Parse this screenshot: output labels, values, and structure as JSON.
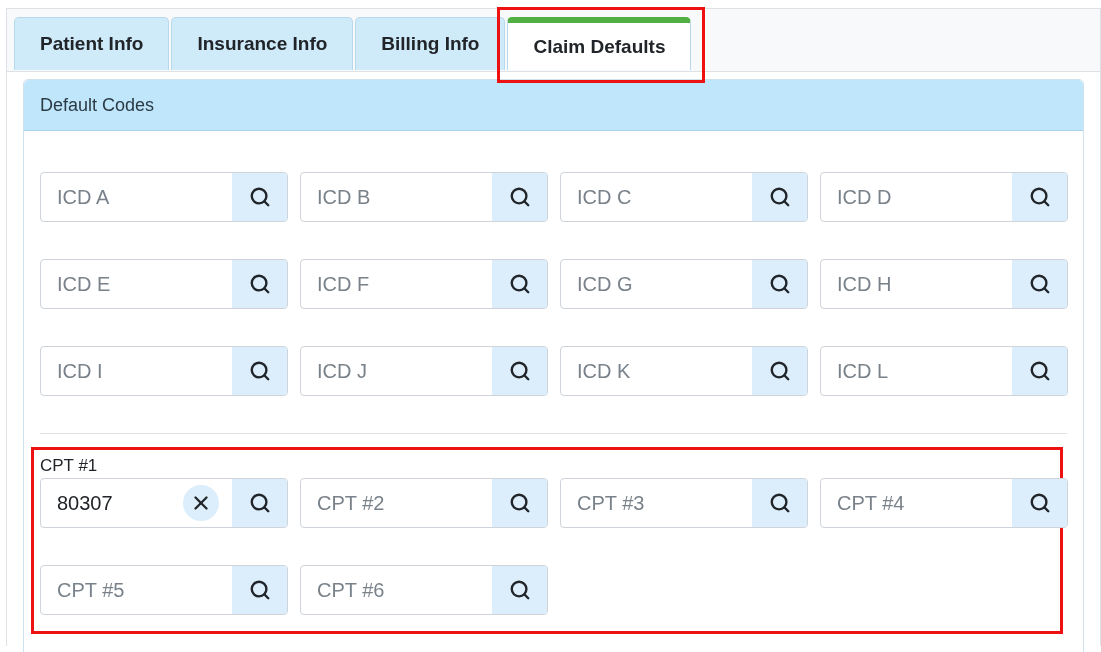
{
  "tabs": [
    {
      "label": "Patient Info",
      "selected": false
    },
    {
      "label": "Insurance Info",
      "selected": false
    },
    {
      "label": "Billing Info",
      "selected": false
    },
    {
      "label": "Claim Defaults",
      "selected": true
    }
  ],
  "panel": {
    "title": "Default Codes"
  },
  "icd_fields": [
    {
      "placeholder": "ICD A"
    },
    {
      "placeholder": "ICD B"
    },
    {
      "placeholder": "ICD C"
    },
    {
      "placeholder": "ICD D"
    },
    {
      "placeholder": "ICD E"
    },
    {
      "placeholder": "ICD F"
    },
    {
      "placeholder": "ICD G"
    },
    {
      "placeholder": "ICD H"
    },
    {
      "placeholder": "ICD I"
    },
    {
      "placeholder": "ICD J"
    },
    {
      "placeholder": "ICD K"
    },
    {
      "placeholder": "ICD L"
    }
  ],
  "cpt_fields": [
    {
      "label": "CPT #1",
      "value": "80307"
    },
    {
      "placeholder": "CPT #2"
    },
    {
      "placeholder": "CPT #3"
    },
    {
      "placeholder": "CPT #4"
    },
    {
      "placeholder": "CPT #5"
    },
    {
      "placeholder": "CPT #6"
    }
  ]
}
